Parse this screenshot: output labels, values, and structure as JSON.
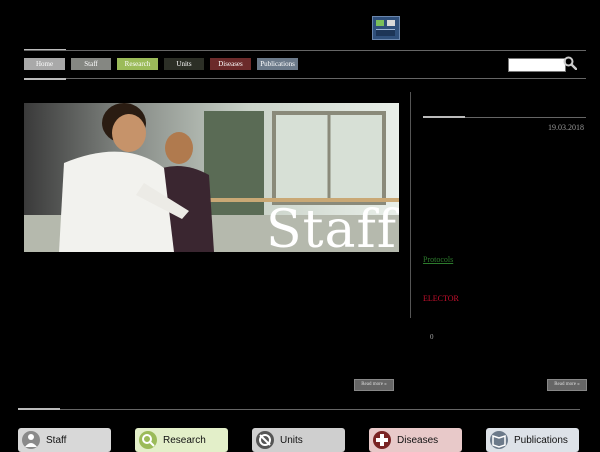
{
  "nav": {
    "items": [
      {
        "label": "Home",
        "bg": "#a9a9a9",
        "width": 41
      },
      {
        "label": "Staff",
        "bg": "#858782",
        "width": 40
      },
      {
        "label": "Research",
        "bg": "#9bbb59",
        "width": 41
      },
      {
        "label": "Units",
        "bg": "#2c2f26",
        "width": 40
      },
      {
        "label": "Diseases",
        "bg": "#6b2a2a",
        "width": 41
      },
      {
        "label": "Publications",
        "bg": "#6c7a8a",
        "width": 41
      }
    ]
  },
  "hero": {
    "title": "Staff"
  },
  "sidebar": {
    "date": "19.03.2018",
    "protocols_link": "Protocols",
    "elector_text": "ELECTOR",
    "small_text": "0"
  },
  "readmore": {
    "left_label": "Read more »",
    "right_label": "Read more »"
  },
  "categories": [
    {
      "label": "Staff",
      "bg": "#d8d8d8",
      "icon": "person-icon",
      "icon_color": "#8a8a8a"
    },
    {
      "label": "Research",
      "bg": "#e3efc9",
      "icon": "magnifier-icon",
      "icon_color": "#9bbb59"
    },
    {
      "label": "Units",
      "bg": "#cfcfcf",
      "icon": "stethoscope-icon",
      "icon_color": "#555"
    },
    {
      "label": "Diseases",
      "bg": "#e8c9c9",
      "icon": "cross-icon",
      "icon_color": "#7a2424"
    },
    {
      "label": "Publications",
      "bg": "#dde2e8",
      "icon": "book-icon",
      "icon_color": "#6c7a8a"
    }
  ]
}
